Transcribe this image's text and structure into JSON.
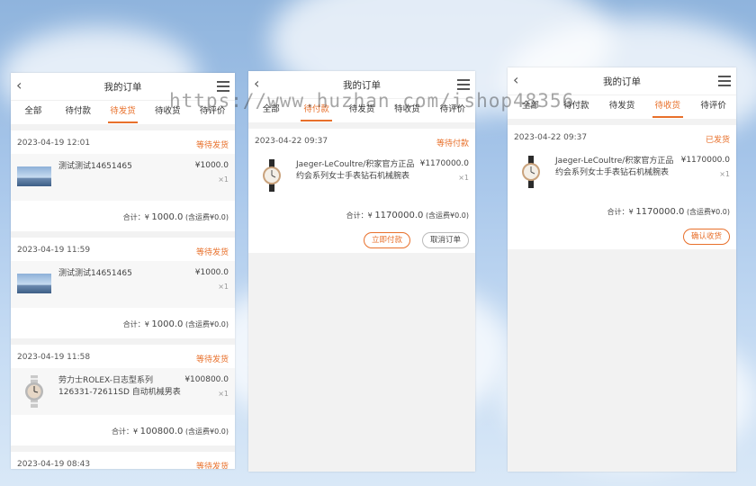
{
  "screen": {
    "title": "我的订单",
    "watermark": "https://www.huzhan.com/ishop48356"
  },
  "panels": [
    {
      "tabs": [
        "全部",
        "待付款",
        "待发货",
        "待收货",
        "待评价"
      ],
      "active_tab": 2,
      "orders": [
        {
          "date": "2023-04-19 12:01",
          "status": "等待发货",
          "item": "测试测试14651465",
          "price": "¥1000.0",
          "qty": "×1",
          "total_label": "合计：¥",
          "total_amount": "1000.0",
          "shipping": "(含运费¥0.0)",
          "thumb": "sky"
        },
        {
          "date": "2023-04-19 11:59",
          "status": "等待发货",
          "item": "测试测试14651465",
          "price": "¥1000.0",
          "qty": "×1",
          "total_label": "合计：¥",
          "total_amount": "1000.0",
          "shipping": "(含运费¥0.0)",
          "thumb": "sky"
        },
        {
          "date": "2023-04-19 11:58",
          "status": "等待发货",
          "item": "劳力士ROLEX-日志型系列 126331-72611SD 自动机械男表",
          "price": "¥100800.0",
          "qty": "×1",
          "total_label": "合计：¥",
          "total_amount": "100800.0",
          "shipping": "(含运费¥0.0)",
          "thumb": "watch"
        },
        {
          "date": "2023-04-19 08:43",
          "status": "等待发货"
        }
      ]
    },
    {
      "tabs": [
        "全部",
        "待付款",
        "待发货",
        "待收货",
        "待评价"
      ],
      "active_tab": 1,
      "orders": [
        {
          "date": "2023-04-22 09:37",
          "status": "等待付款",
          "item": "Jaeger-LeCoultre/积家官方正品 约会系列女士手表钻石机械腕表",
          "price": "¥1170000.0",
          "qty": "×1",
          "total_label": "合计：¥",
          "total_amount": "1170000.0",
          "shipping": "(含运费¥0.0)",
          "thumb": "watch2",
          "buttons": [
            "立即付款",
            "取消订单"
          ]
        }
      ]
    },
    {
      "tabs": [
        "全部",
        "待付款",
        "待发货",
        "待收货",
        "待评价"
      ],
      "active_tab": 3,
      "orders": [
        {
          "date": "2023-04-22 09:37",
          "status": "已发货",
          "item": "Jaeger-LeCoultre/积家官方正品 约会系列女士手表钻石机械腕表",
          "price": "¥1170000.0",
          "qty": "×1",
          "total_label": "合计：¥",
          "total_amount": "1170000.0",
          "shipping": "(含运费¥0.0)",
          "thumb": "watch2",
          "buttons": [
            "确认收货"
          ]
        }
      ]
    }
  ]
}
